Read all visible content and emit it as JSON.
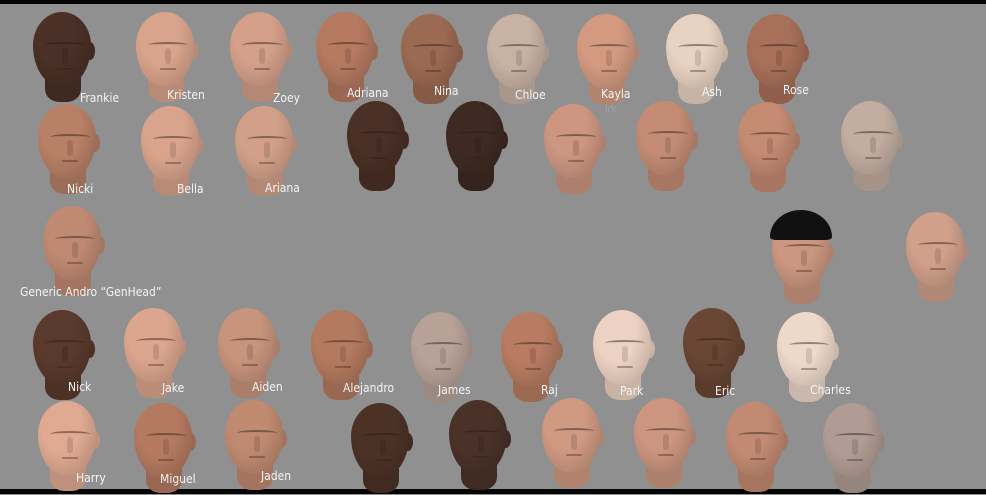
{
  "heads": [
    {
      "name": "Frankie",
      "skin": "#4a3026"
    },
    {
      "name": "Kristen",
      "skin": "#d9a48c"
    },
    {
      "name": "Zoey",
      "skin": "#d4a08a"
    },
    {
      "name": "Adriana",
      "skin": "#b57a60"
    },
    {
      "name": "Nina",
      "skin": "#9c6a52"
    },
    {
      "name": "Chloe",
      "skin": "#c8b2a4"
    },
    {
      "name": "Kayla",
      "skin": "#d39a80"
    },
    {
      "name": "Ash",
      "skin": "#e8d2c2"
    },
    {
      "name": "Rose",
      "skin": "#a87058"
    },
    {
      "name": "Nicki",
      "skin": "#b88066"
    },
    {
      "name": "Bella",
      "skin": "#d9a48c"
    },
    {
      "name": "Ariana",
      "skin": "#d2a088"
    },
    {
      "name": "",
      "skin": "#4a3026"
    },
    {
      "name": "",
      "skin": "#3e2a22"
    },
    {
      "name": "",
      "skin": "#cc9680"
    },
    {
      "name": "",
      "skin": "#c48c74"
    },
    {
      "name": "",
      "skin": "#c48a72"
    },
    {
      "name": "",
      "skin": "#c2ada0"
    },
    {
      "name": "Generic Andro “GenHead”",
      "skin": "#c08a72"
    },
    {
      "name": "",
      "skin": "#cb9780",
      "hair": true
    },
    {
      "name": "",
      "skin": "#d0a08a"
    },
    {
      "name": "Nick",
      "skin": "#5a3a2c"
    },
    {
      "name": "Jake",
      "skin": "#dca68e"
    },
    {
      "name": "Aiden",
      "skin": "#c8947c"
    },
    {
      "name": "Alejandro",
      "skin": "#b47a60"
    },
    {
      "name": "James",
      "skin": "#b8a298"
    },
    {
      "name": "Raj",
      "skin": "#b77c62"
    },
    {
      "name": "Park",
      "skin": "#ecd2c2"
    },
    {
      "name": "Eric",
      "skin": "#6a4634"
    },
    {
      "name": "Charles",
      "skin": "#eed8ca"
    },
    {
      "name": "Harry",
      "skin": "#e0aa92"
    },
    {
      "name": "Miguel",
      "skin": "#b47a60"
    },
    {
      "name": "Jaden",
      "skin": "#c08a70"
    },
    {
      "name": "",
      "skin": "#4c3226"
    },
    {
      "name": "",
      "skin": "#4a3228"
    },
    {
      "name": "",
      "skin": "#d09a82"
    },
    {
      "name": "",
      "skin": "#cc9680"
    },
    {
      "name": "",
      "skin": "#c28a72"
    },
    {
      "name": "",
      "skin": "#b09c94"
    }
  ],
  "stray_text": "Irk",
  "background": "#909090"
}
